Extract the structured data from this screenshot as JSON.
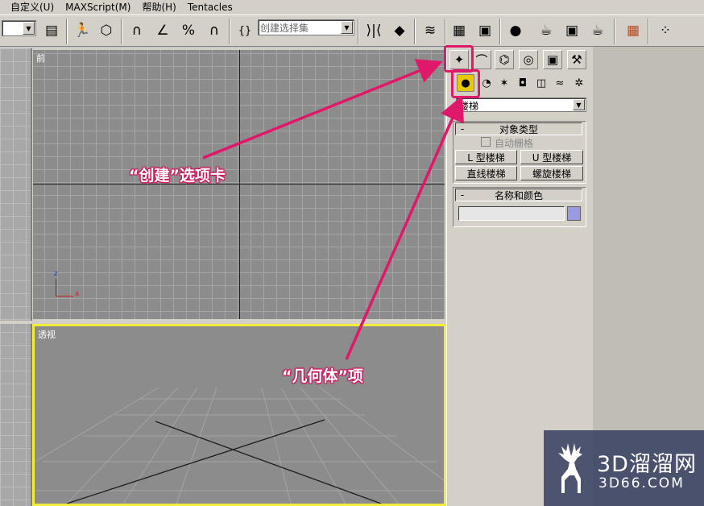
{
  "menu": {
    "items": [
      "自定义(U)",
      "MAXScript(M)",
      "帮助(H)",
      "Tentacles"
    ]
  },
  "toolbar": {
    "selection_set_combo": "创建选择集",
    "icons": [
      "render-frame-icon",
      "walk-icon",
      "box-icon",
      "snap-3d-icon",
      "angle-snap-icon",
      "percent-snap-icon",
      "spinner-snap-icon",
      "named-selection-icon",
      "mirror-icon",
      "align-icon",
      "layers-icon",
      "curve-editor-icon",
      "schematic-icon",
      "material-editor-icon",
      "render-setup-icon",
      "rendered-frame-icon",
      "quick-render-icon",
      "grid-icon",
      "particle-icon"
    ]
  },
  "viewports": {
    "front_label": "前",
    "persp_label": "透视",
    "axis_z": "z",
    "axis_x": "x",
    "active_border_color": "#f2ed3c"
  },
  "command_panel": {
    "tabs": [
      "create-tab",
      "modify-tab",
      "hierarchy-tab",
      "motion-tab",
      "display-tab",
      "utilities-tab"
    ],
    "categories": [
      "geometry",
      "shapes",
      "lights",
      "cameras",
      "helpers",
      "space-warps",
      "systems"
    ],
    "subcategory_select": "楼梯",
    "object_type_rollout": {
      "title": "对象类型",
      "collapse_glyph": "-",
      "auto_grid_label": "自动栅格",
      "buttons": [
        "L 型楼梯",
        "U 型楼梯",
        "直线楼梯",
        "螺旋楼梯"
      ]
    },
    "name_color_rollout": {
      "title": "名称和颜色",
      "collapse_glyph": "-",
      "name_value": "",
      "swatch_color": "#9a9ae0"
    }
  },
  "annotations": {
    "create_tab": "“创建”选项卡",
    "geometry_item": "“几何体”项",
    "color": "#e0186a"
  },
  "watermark": {
    "brand": "3D溜溜网",
    "url": "3D66.COM"
  }
}
